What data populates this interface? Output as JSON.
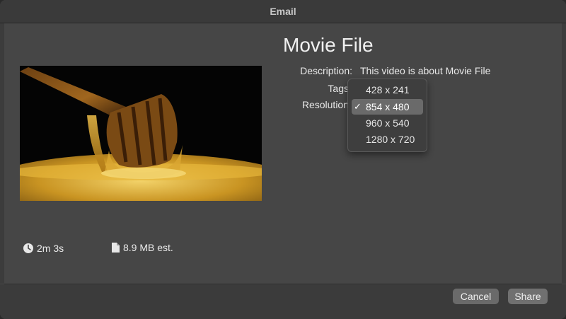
{
  "window": {
    "title": "Email"
  },
  "project": {
    "title": "Movie File",
    "description_label": "Description:",
    "description_value": "This video is about Movie File",
    "tags_label": "Tags",
    "resolution_label": "Resolution"
  },
  "resolution_menu": {
    "options": [
      "428 x 241",
      "854 x 480",
      "960 x 540",
      "1280 x 720"
    ],
    "selected": "854 x 480",
    "check_mark": "✓"
  },
  "meta": {
    "duration": "2m 3s",
    "size": "8.9 MB est.",
    "duration_icon": "clock-icon",
    "size_icon": "document-icon"
  },
  "buttons": {
    "cancel": "Cancel",
    "share": "Share"
  },
  "colors": {
    "dialog_bg": "#464646",
    "selected_item": "#6a6a6a",
    "honey": "#c9961e"
  }
}
